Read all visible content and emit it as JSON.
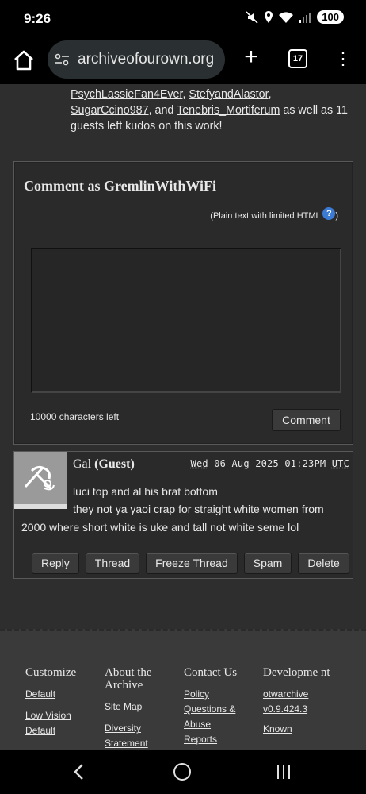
{
  "status": {
    "time": "9:26",
    "battery": "100"
  },
  "browser": {
    "url": "archiveofourown.org",
    "tab_count": "17"
  },
  "kudos": {
    "users": [
      "PsychLassieFan4Ever",
      "StefyandAlastor",
      "SugarCcino987",
      "Tenebris_Mortiferum"
    ],
    "sep1": ", ",
    "sep2": ", and ",
    "suffix": " as well as 11 guests left kudos on this work!"
  },
  "comment_form": {
    "heading_prefix": "Comment as ",
    "username": "GremlinWithWiFi",
    "html_note": "(Plain text with limited HTML ",
    "html_note_end": ")",
    "help_icon": "?",
    "chars_left": "10000 characters left",
    "submit_label": "Comment"
  },
  "comment": {
    "author": "Gal",
    "author_tag": "(Guest)",
    "date_weekday": "Wed",
    "date_rest": " 06 Aug 2025 01:23PM ",
    "date_tz": "UTC",
    "line1": "luci top and al his brat bottom",
    "line2": "they not ya yaoi crap for straight white women from",
    "line3": "2000 where short white is uke and tall not white seme lol",
    "actions": [
      "Reply",
      "Thread",
      "Freeze Thread",
      "Spam",
      "Delete"
    ]
  },
  "footer": {
    "columns": [
      {
        "heading": "Customize",
        "links": [
          "Default",
          "Low Vision",
          "Default"
        ]
      },
      {
        "heading": "About the Archive",
        "links": [
          "Site Map",
          "Diversity",
          "Statement"
        ]
      },
      {
        "heading": "Contact Us",
        "links": [
          "Policy",
          "Questions &",
          "Abuse",
          "Reports"
        ]
      },
      {
        "heading": "Developme nt",
        "links": [
          "otwarchive",
          "v0.9.424.3",
          "Known"
        ]
      }
    ]
  }
}
